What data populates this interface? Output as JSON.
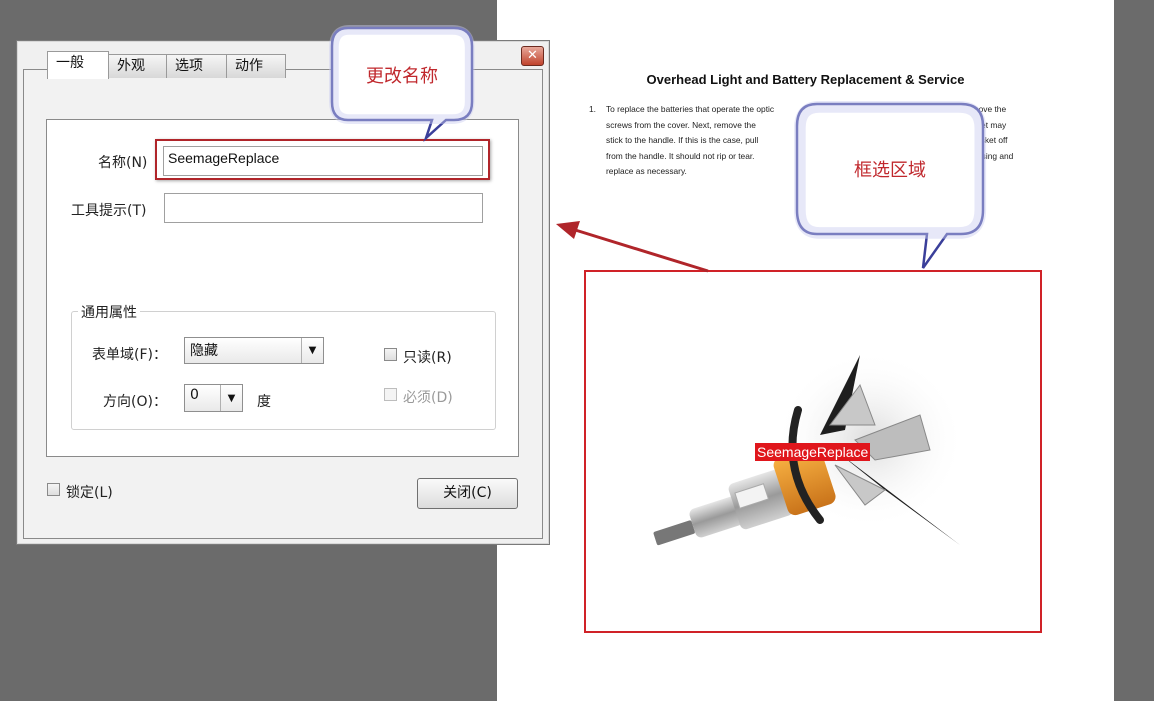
{
  "document": {
    "title": "Overhead Light and Battery Replacement & Service",
    "list_number": "1.",
    "lines": [
      "To replace the batteries that operate the optic",
      "screws from the cover.  Next, remove the",
      "stick to the handle.  If this is the case, pull",
      "from the handle.  It should not rip or tear.",
      "replace as necessary."
    ],
    "line_ends": [
      "emove the",
      "asket may",
      "asket off",
      "using and",
      ""
    ]
  },
  "dialog": {
    "close_glyph": "✕",
    "tabs": [
      {
        "label": "一般",
        "active": true
      },
      {
        "label": "外观",
        "active": false
      },
      {
        "label": "选项",
        "active": false
      },
      {
        "label": "动作",
        "active": false
      }
    ],
    "name_label": "名称(N)",
    "name_value": "SeemageReplace",
    "tooltip_label": "工具提示(T)",
    "tooltip_value": "",
    "group_title": "通用属性",
    "form_field_label": "表单域(F)：",
    "form_field_value": "隐藏",
    "orientation_label": "方向(O)：",
    "orientation_value": "0",
    "degree_unit": "度",
    "readonly_label": "只读(R)",
    "readonly_checked": false,
    "required_label": "必须(D)",
    "required_checked": false,
    "locked_label": "锁定(L)",
    "locked_checked": false,
    "close_button": "关闭(C)"
  },
  "callouts": {
    "rename": "更改名称",
    "region": "框选区域"
  },
  "selection": {
    "field_name": "SeemageReplace"
  },
  "colors": {
    "accent_red": "#d02228",
    "callout_border": "#3a3f9a",
    "callout_text": "#c0282d",
    "workspace_gray": "#6b6b6b"
  }
}
